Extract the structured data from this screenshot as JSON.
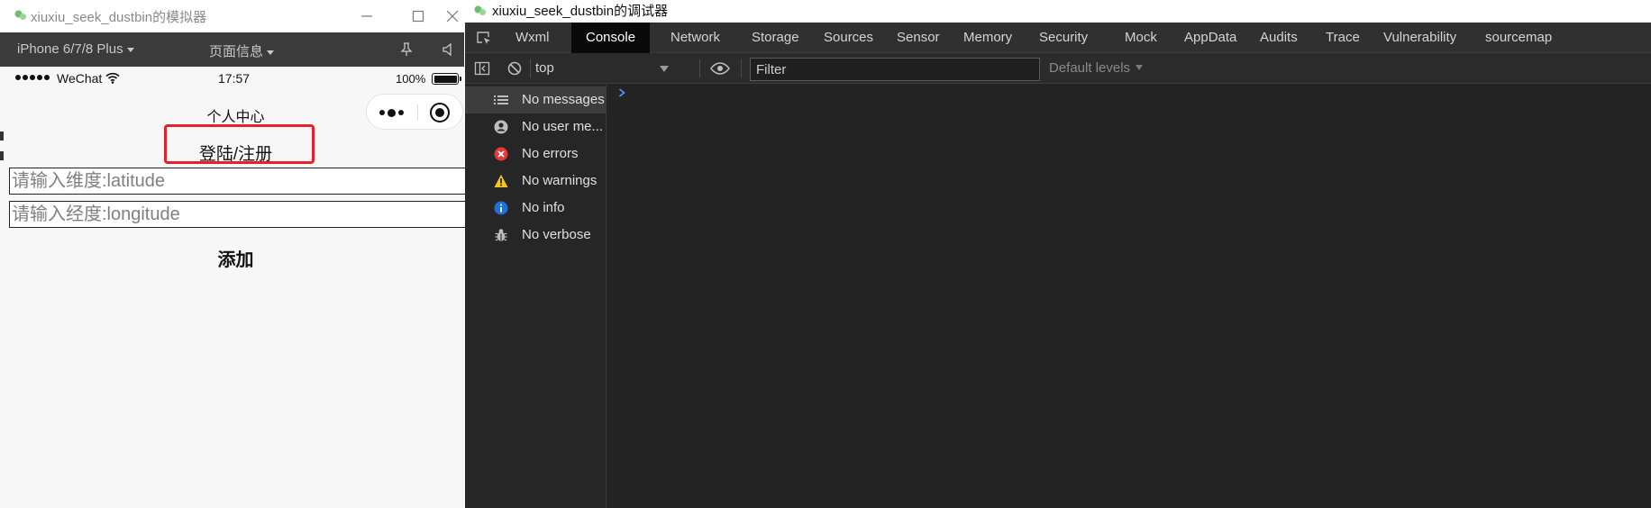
{
  "simulator": {
    "title": "xiuxiu_seek_dustbin的模拟器",
    "toolbar": {
      "device": "iPhone 6/7/8 Plus",
      "page_info": "页面信息"
    },
    "statusbar": {
      "carrier": "WeChat",
      "time": "17:57",
      "battery_percent": "100%"
    },
    "page": {
      "nav_title": "个人中心",
      "login_link": "登陆/注册",
      "latitude_placeholder": "请输入维度:latitude",
      "longitude_placeholder": "请输入经度:longitude",
      "add_button": "添加"
    },
    "highlight_color": "#e6212a"
  },
  "debugger": {
    "title": "xiuxiu_seek_dustbin的调试器",
    "tabs": [
      {
        "label": "Wxml"
      },
      {
        "label": "Console",
        "active": true
      },
      {
        "label": "Network"
      },
      {
        "label": "Storage"
      },
      {
        "label": "Sources"
      },
      {
        "label": "Sensor"
      },
      {
        "label": "Memory"
      },
      {
        "label": "Security"
      },
      {
        "label": "Mock"
      },
      {
        "label": "AppData"
      },
      {
        "label": "Audits"
      },
      {
        "label": "Trace"
      },
      {
        "label": "Vulnerability"
      },
      {
        "label": "sourcemap"
      }
    ],
    "console_bar": {
      "context": "top",
      "filter_placeholder": "Filter",
      "levels": "Default levels"
    },
    "sidebar": [
      {
        "label": "No messages",
        "icon": "list-icon",
        "selected": true
      },
      {
        "label": "No user me...",
        "icon": "user-icon"
      },
      {
        "label": "No errors",
        "icon": "error-icon",
        "color": "#e53935"
      },
      {
        "label": "No warnings",
        "icon": "warning-icon",
        "color": "#f5c518"
      },
      {
        "label": "No info",
        "icon": "info-icon",
        "color": "#1e6fd9"
      },
      {
        "label": "No verbose",
        "icon": "bug-icon"
      }
    ],
    "colors": {
      "active_tab_bg": "#0a0a0a",
      "panel_bg": "#242424",
      "prompt": "#4a9eff"
    }
  }
}
